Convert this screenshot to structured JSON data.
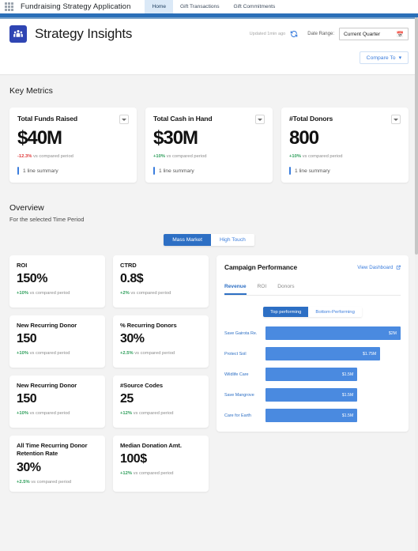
{
  "appnav": {
    "app_launcher_icon": "waffle-grid-icon",
    "app_name": "Fundraising Strategy Application",
    "tabs": [
      {
        "label": "Home",
        "active": true
      },
      {
        "label": "Gift Transactions",
        "active": false
      },
      {
        "label": "Gift Commitments",
        "active": false
      }
    ]
  },
  "header": {
    "brand_icon": "people-group-icon",
    "title": "Strategy Insights",
    "updated_text": "Updated 1min ago",
    "refresh_icon": "refresh-icon",
    "date_range_label": "Date Range:",
    "date_range_value": "Current Quarter",
    "calendar_icon": "calendar-icon",
    "compare_to_label": "Compare To",
    "compare_caret": "▾",
    "accent_color": "#3b7ddd"
  },
  "key_metrics": {
    "section_title": "Key Metrics",
    "cards": [
      {
        "title": "Total Funds Raised",
        "value": "$40M",
        "delta": "-12.3%",
        "delta_dir": "neg",
        "delta_label": "vs compared period",
        "summary": "1 line summary",
        "menu_icon": "chevron-down-icon"
      },
      {
        "title": "Total Cash in Hand",
        "value": "$30M",
        "delta": "+10%",
        "delta_dir": "pos",
        "delta_label": "vs compared period",
        "summary": "1 line summary",
        "menu_icon": "chevron-down-icon"
      },
      {
        "title": "#Total Donors",
        "value": "800",
        "delta": "+10%",
        "delta_dir": "pos",
        "delta_label": "vs compared period",
        "summary": "1 line summary",
        "menu_icon": "chevron-down-icon"
      }
    ]
  },
  "overview": {
    "section_title": "Overview",
    "subtitle": "For the selected Time Period",
    "segment": [
      {
        "label": "Mass Market",
        "active": true
      },
      {
        "label": "High Touch",
        "active": false
      }
    ],
    "mini_cards": [
      {
        "title": "ROI",
        "value": "150%",
        "delta": "+10%",
        "delta_dir": "pos",
        "delta_label": "vs compared period"
      },
      {
        "title": "CTRD",
        "value": "0.8$",
        "delta": "+2%",
        "delta_dir": "pos",
        "delta_label": "vs compared period"
      },
      {
        "title": "New Recurring Donor",
        "value": "150",
        "delta": "+10%",
        "delta_dir": "pos",
        "delta_label": "vs compared period"
      },
      {
        "title": "% Recurring Donors",
        "value": "30%",
        "delta": "+2.5%",
        "delta_dir": "pos",
        "delta_label": "vs compared period"
      },
      {
        "title": "New Recurring Donor",
        "value": "150",
        "delta": "+10%",
        "delta_dir": "pos",
        "delta_label": "vs compared period"
      },
      {
        "title": "#Source Codes",
        "value": "25",
        "delta": "+12%",
        "delta_dir": "pos",
        "delta_label": "vs compared period"
      },
      {
        "title": "All Time Recurring Donor Retention Rate",
        "value": "30%",
        "delta": "+2.5%",
        "delta_dir": "pos",
        "delta_label": "vs compared period"
      },
      {
        "title": "Median Donation Amt.",
        "value": "100$",
        "delta": "+12%",
        "delta_dir": "pos",
        "delta_label": "vs compared period"
      }
    ]
  },
  "campaign_performance": {
    "title": "Campaign Performance",
    "view_dashboard_label": "View Dashboard",
    "view_dashboard_icon": "external-link-icon",
    "tabs": [
      {
        "label": "Revenue",
        "active": true
      },
      {
        "label": "ROI",
        "active": false
      },
      {
        "label": "Donors",
        "active": false
      }
    ],
    "segment": [
      {
        "label": "Top performing",
        "active": true
      },
      {
        "label": "Bottom-Performing",
        "active": false
      }
    ]
  },
  "chart_data": {
    "type": "bar",
    "title": "Campaign Performance",
    "orientation": "horizontal",
    "series_name": "Revenue",
    "categories": [
      "Save Gairota Re.",
      "Protect Soil",
      "Wildlife Care",
      "Save Mangrove",
      "Care for Earth"
    ],
    "values": [
      2000000,
      1750000,
      1500000,
      1500000,
      1500000
    ],
    "value_labels": [
      "$2M",
      "$1.75M",
      "$1.5M",
      "$1.5M",
      "$1.5M"
    ],
    "bar_pct": [
      100,
      85,
      68,
      68,
      68
    ],
    "bar_color": "#4a8ae0",
    "xlabel": "",
    "ylabel": "",
    "legend": "none",
    "grid": false
  }
}
